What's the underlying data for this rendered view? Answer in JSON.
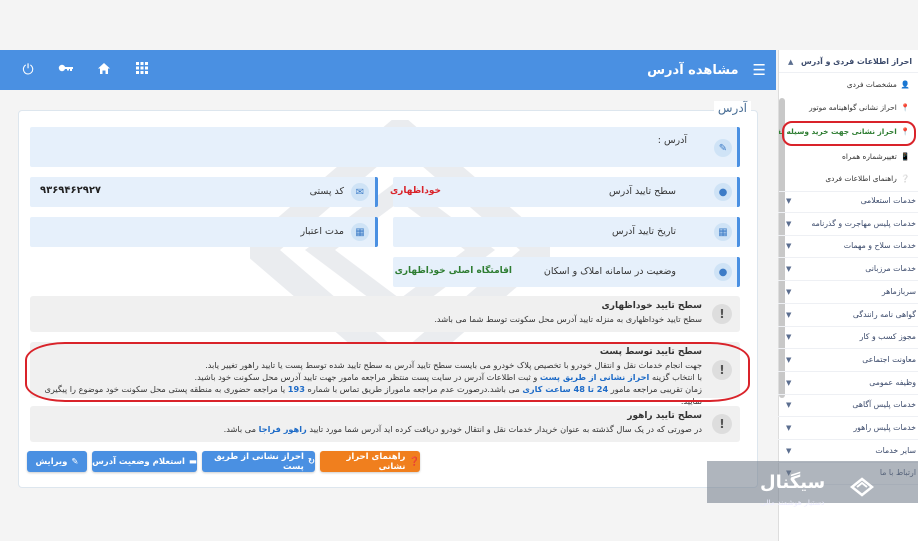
{
  "topbar": {
    "title": "مشاهده آدرس",
    "icons": [
      "menu-icon",
      "power-icon",
      "key-icon",
      "home-icon",
      "grid-icon"
    ]
  },
  "panel": {
    "title": "آدرس"
  },
  "fields": {
    "address_label": "آدرس :",
    "postal_label": "کد پستی",
    "postal_value": "۹۳۶۹۴۶۲۹۲۷",
    "confirm_level_label": "سطح تایید آدرس",
    "confirm_level_value": "خوداظهاری",
    "confirm_date_label": "تاریخ تایید آدرس",
    "validity_label": "مدت اعتبار",
    "property_status_label": "وضعیت در سامانه املاک و اسکان",
    "property_status_value": "اقامتگاه اصلی خوداظهاری"
  },
  "notes": {
    "self_title": "سطح تایید خوداظهاری",
    "self_body": "سطح تایید خوداظهاری به منزله تایید آدرس محل سکونت توسط شما می باشد.",
    "post_title": "سطح تایید توسط پست",
    "post_l1": "جهت انجام خدمات نقل و انتقال خودرو با تخصیص پلاک خودرو می بایست سطح تایید آدرس به سطح تایید شده توسط پست یا تایید راهور تغییر یابد.",
    "post_l2a": "با انتخاب گزینه",
    "post_l2b": "احراز نشانی از طریق پست",
    "post_l2c": "و ثبت اطلاعات آدرس در سایت پست منتظر مراجعه مامور جهت تایید آدرس محل سکونت خود باشید.",
    "post_l3a": "زمان تقریبی مراجعه مامور",
    "post_l3b": "24 تا 48 ساعت کاری",
    "post_l3c": "می باشد.درصورت عدم مراجعه ماموراز طریق تماس با شماره",
    "post_l3d": "193",
    "post_l3e": "یا مراجعه حضوری به منطقه پستی محل سکونت خود موضوع را پیگیری نمایید.",
    "rahvar_title": "سطح تایید راهور",
    "rahvar_a": "در صورتی که در یک سال گذشته به عنوان خریدار خدمات نقل و انتقال خودرو دریافت کرده اید آدرس شما مورد تایید",
    "rahvar_b": "راهور فراجا",
    "rahvar_c": "می باشد."
  },
  "buttons": {
    "guide": "راهنمای احراز نشانی",
    "post_verify": "احراز نشانی از طریق پست",
    "inquiry": "استعلام وضعیت آدرس",
    "edit": "ویرایش"
  },
  "colors": {
    "primary": "#4a90e2",
    "orange": "#f07f1e",
    "red": "#d9232a",
    "green": "#2e7d32"
  },
  "sidebar": {
    "header": "احراز اطلاعات فردی و آدرس",
    "subs": [
      {
        "label": "مشخصات فردی",
        "icon": "person-icon"
      },
      {
        "label": "احراز نشانی گواهینامه موتور",
        "icon": "pin-icon"
      },
      {
        "label": "احراز نشانی جهت خرید وسیله نقلیه",
        "icon": "pin-icon"
      },
      {
        "label": "تغییرشماره همراه",
        "icon": "phone-icon"
      },
      {
        "label": "راهنمای اطلاعات فردی",
        "icon": "help-icon"
      }
    ],
    "sections": [
      "خدمات استعلامی",
      "خدمات پلیس مهاجرت و گذرنامه",
      "خدمات سلاح و مهمات",
      "خدمات مرزبانی",
      "سربازماهر",
      "گواهی نامه رانندگی",
      "مجوز کسب و کار",
      "معاونت اجتماعی",
      "وظیفه عمومی",
      "خدمات پلیس آگاهی",
      "خدمات پلیس راهور",
      "سایر خدمات",
      "ارتباط با ما"
    ]
  },
  "overlay": {
    "brand": "سیگنال",
    "subtitle": "دستیار هوشمند مالی"
  }
}
